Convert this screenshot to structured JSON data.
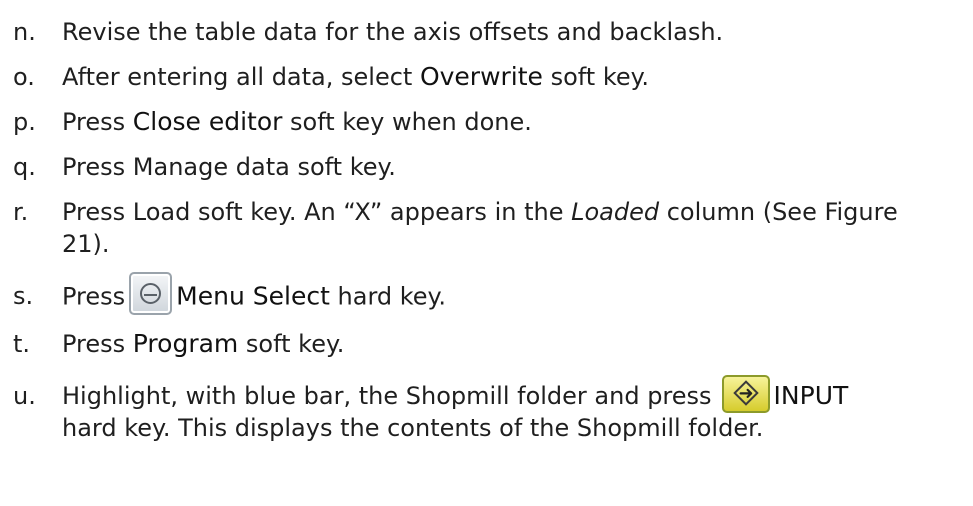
{
  "steps": [
    {
      "letter": "n.",
      "parts": [
        "Revise the table data for the axis offsets and backlash."
      ]
    },
    {
      "letter": "o.",
      "parts": [
        "After entering all data, select ",
        "Overwrite",
        " soft key."
      ]
    },
    {
      "letter": "p.",
      "parts": [
        "Press ",
        "Close editor",
        " soft key when done."
      ]
    },
    {
      "letter": "q.",
      "parts": [
        "Press Manage data soft key."
      ]
    },
    {
      "letter": "r.",
      "parts": [
        "Press Load soft key. An “X” appears in the ",
        "Loaded",
        " column (See Figure",
        "21)."
      ]
    },
    {
      "letter": "s.",
      "parts": [
        "Press",
        "Menu Select",
        " hard key."
      ],
      "icon": "menu-select-key-icon"
    },
    {
      "letter": "t.",
      "parts": [
        "Press ",
        "Program",
        " soft key."
      ]
    },
    {
      "letter": "u.",
      "parts": [
        "Highlight, with blue bar, the Shopmill folder and press",
        "INPUT",
        "hard key. This displays the contents of the Shopmill folder."
      ],
      "icon": "input-key-icon"
    }
  ]
}
